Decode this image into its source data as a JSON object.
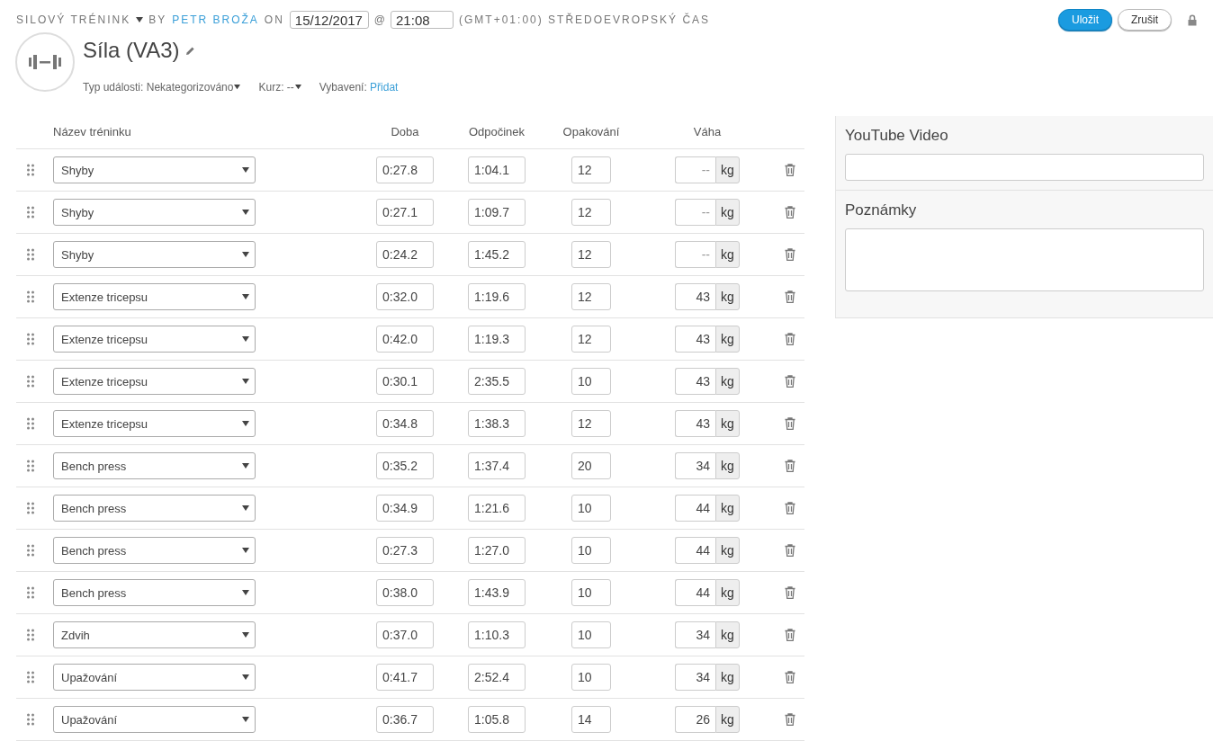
{
  "header": {
    "activity_type": "SILOVÝ TRÉNINK",
    "by": "BY",
    "author": "PETR BROŽA",
    "on": "ON",
    "date": "15/12/2017",
    "at": "@",
    "time": "21:08",
    "timezone": "(GMT+01:00) STŘEDOEVROPSKÝ ČAS"
  },
  "actions": [
    {
      "label": "Uložit",
      "kind": "primary"
    },
    {
      "label": "Zrušit",
      "kind": "secondary"
    }
  ],
  "title": "Síla (VA3)",
  "meta": {
    "event_type_label": "Typ události:",
    "event_type": "Nekategorizováno",
    "course_label": "Kurz:",
    "course": "--",
    "equipment_label": "Vybavení:",
    "equipment_link": "Přidat"
  },
  "table": {
    "columns": [
      "Název tréninku",
      "Doba",
      "Odpočinek",
      "Opakování",
      "Váha"
    ],
    "rows": [
      {
        "exercise": "Shyby",
        "duration": "0:27.8",
        "rest": "1:04.1",
        "reps": "12",
        "weight_placeholder": "--",
        "unit": "kg"
      },
      {
        "exercise": "Shyby",
        "duration": "0:27.1",
        "rest": "1:09.7",
        "reps": "12",
        "weight_placeholder": "--",
        "unit": "kg"
      },
      {
        "exercise": "Shyby",
        "duration": "0:24.2",
        "rest": "1:45.2",
        "reps": "12",
        "weight_placeholder": "--",
        "unit": "kg"
      },
      {
        "exercise": "Extenze tricepsu",
        "duration": "0:32.0",
        "rest": "1:19.6",
        "reps": "12",
        "weight": "43",
        "unit": "kg"
      },
      {
        "exercise": "Extenze tricepsu",
        "duration": "0:42.0",
        "rest": "1:19.3",
        "reps": "12",
        "weight": "43",
        "unit": "kg"
      },
      {
        "exercise": "Extenze tricepsu",
        "duration": "0:30.1",
        "rest": "2:35.5",
        "reps": "10",
        "weight": "43",
        "unit": "kg"
      },
      {
        "exercise": "Extenze tricepsu",
        "duration": "0:34.8",
        "rest": "1:38.3",
        "reps": "12",
        "weight": "43",
        "unit": "kg"
      },
      {
        "exercise": "Bench press",
        "duration": "0:35.2",
        "rest": "1:37.4",
        "reps": "20",
        "weight": "34",
        "unit": "kg"
      },
      {
        "exercise": "Bench press",
        "duration": "0:34.9",
        "rest": "1:21.6",
        "reps": "10",
        "weight": "44",
        "unit": "kg"
      },
      {
        "exercise": "Bench press",
        "duration": "0:27.3",
        "rest": "1:27.0",
        "reps": "10",
        "weight": "44",
        "unit": "kg"
      },
      {
        "exercise": "Bench press",
        "duration": "0:38.0",
        "rest": "1:43.9",
        "reps": "10",
        "weight": "44",
        "unit": "kg"
      },
      {
        "exercise": "Zdvih",
        "duration": "0:37.0",
        "rest": "1:10.3",
        "reps": "10",
        "weight": "34",
        "unit": "kg"
      },
      {
        "exercise": "Upažování",
        "duration": "0:41.7",
        "rest": "2:52.4",
        "reps": "10",
        "weight": "34",
        "unit": "kg"
      },
      {
        "exercise": "Upažování",
        "duration": "0:36.7",
        "rest": "1:05.8",
        "reps": "14",
        "weight": "26",
        "unit": "kg"
      }
    ]
  },
  "side_panel": {
    "youtube_label": "YouTube Video",
    "notes_label": "Poznámky"
  }
}
